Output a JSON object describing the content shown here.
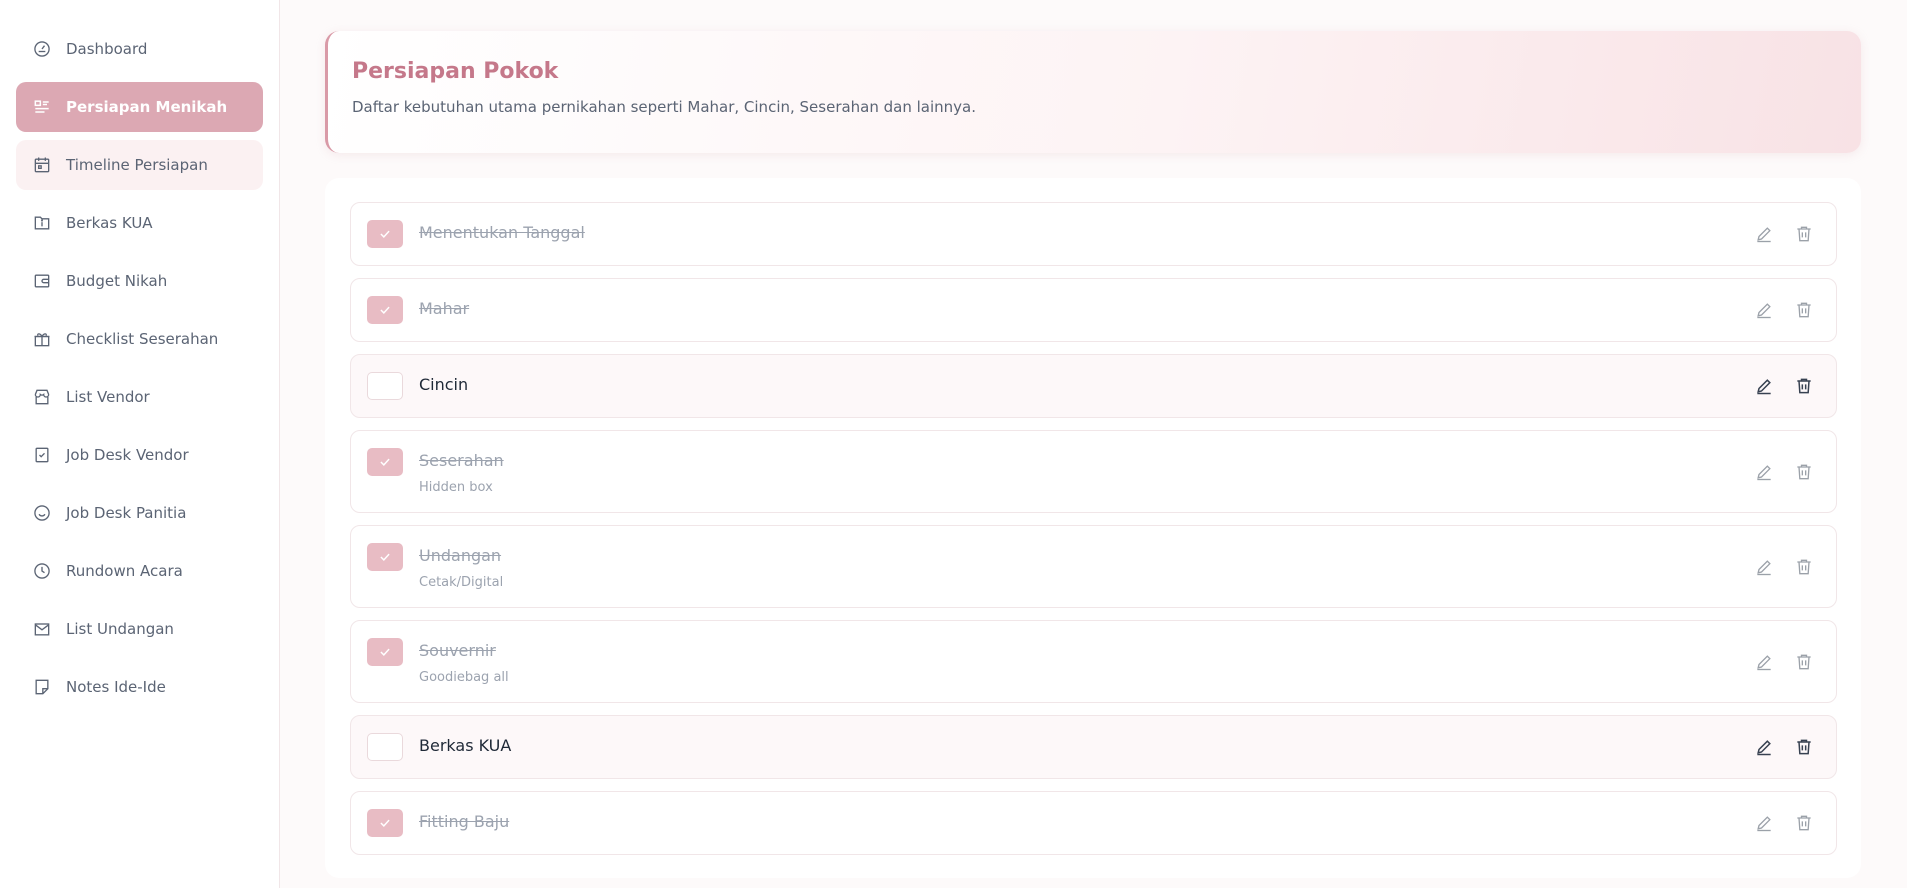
{
  "sidebar": {
    "items": [
      {
        "label": "Dashboard",
        "icon": "speedometer-icon"
      },
      {
        "label": "Persiapan Menikah",
        "icon": "list-icon"
      },
      {
        "label": "Timeline Persiapan",
        "icon": "calendar-icon"
      },
      {
        "label": "Berkas KUA",
        "icon": "folder-icon"
      },
      {
        "label": "Budget Nikah",
        "icon": "wallet-icon"
      },
      {
        "label": "Checklist Seserahan",
        "icon": "gift-icon"
      },
      {
        "label": "List Vendor",
        "icon": "store-icon"
      },
      {
        "label": "Job Desk Vendor",
        "icon": "checkbox-icon"
      },
      {
        "label": "Job Desk Panitia",
        "icon": "smile-icon"
      },
      {
        "label": "Rundown Acara",
        "icon": "clock-icon"
      },
      {
        "label": "List Undangan",
        "icon": "envelope-icon"
      },
      {
        "label": "Notes Ide-Ide",
        "icon": "note-icon"
      }
    ],
    "active_index": 1,
    "hover_index": 2
  },
  "header": {
    "title": "Persiapan Pokok",
    "description": "Daftar kebutuhan utama pernikahan seperti Mahar, Cincin, Seserahan dan lainnya."
  },
  "tasks": [
    {
      "title": "Menentukan Tanggal",
      "note": "",
      "done": true
    },
    {
      "title": "Mahar",
      "note": "",
      "done": true
    },
    {
      "title": "Cincin",
      "note": "",
      "done": false
    },
    {
      "title": "Seserahan",
      "note": "Hidden box",
      "done": true
    },
    {
      "title": "Undangan",
      "note": "Cetak/Digital",
      "done": true
    },
    {
      "title": "Souvernir",
      "note": "Goodiebag all",
      "done": true
    },
    {
      "title": "Berkas KUA",
      "note": "",
      "done": false
    },
    {
      "title": "Fitting Baju",
      "note": "",
      "done": true
    }
  ],
  "colors": {
    "accent": "#dca8b3",
    "title": "#c5788a",
    "check_on": "#e8bcc4"
  }
}
